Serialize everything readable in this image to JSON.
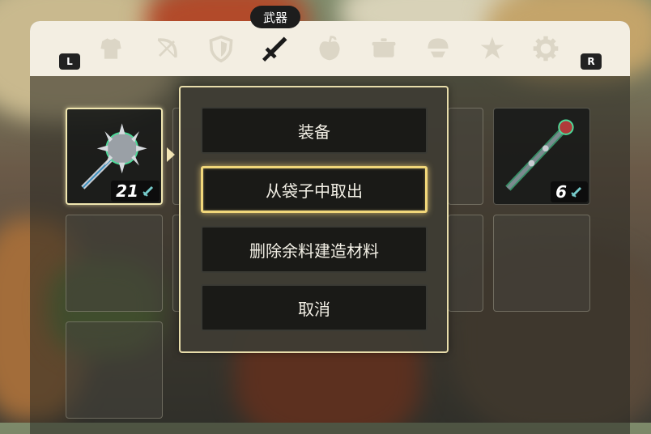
{
  "header": {
    "active_tab_label": "武器",
    "left_shoulder": "L",
    "right_shoulder": "R",
    "tabs": [
      {
        "icon": "armor-icon"
      },
      {
        "icon": "bow-icon"
      },
      {
        "icon": "shield-icon"
      },
      {
        "icon": "sword-icon",
        "active": true
      },
      {
        "icon": "apple-icon"
      },
      {
        "icon": "pot-icon"
      },
      {
        "icon": "key-item-icon"
      },
      {
        "icon": "star-icon"
      },
      {
        "icon": "gear-icon"
      }
    ]
  },
  "slots": [
    {
      "item": "spiked-mace",
      "durability": "21",
      "selected": true
    },
    {
      "item": "magic-rod",
      "durability": "6"
    }
  ],
  "menu": {
    "items": [
      "装备",
      "从袋子中取出",
      "删除余料建造材料",
      "取消"
    ],
    "highlighted_index": 1
  },
  "colors": {
    "tabbar": "#f3eee2",
    "highlight": "#f1d77a",
    "menu_border": "#e7dcaa"
  }
}
